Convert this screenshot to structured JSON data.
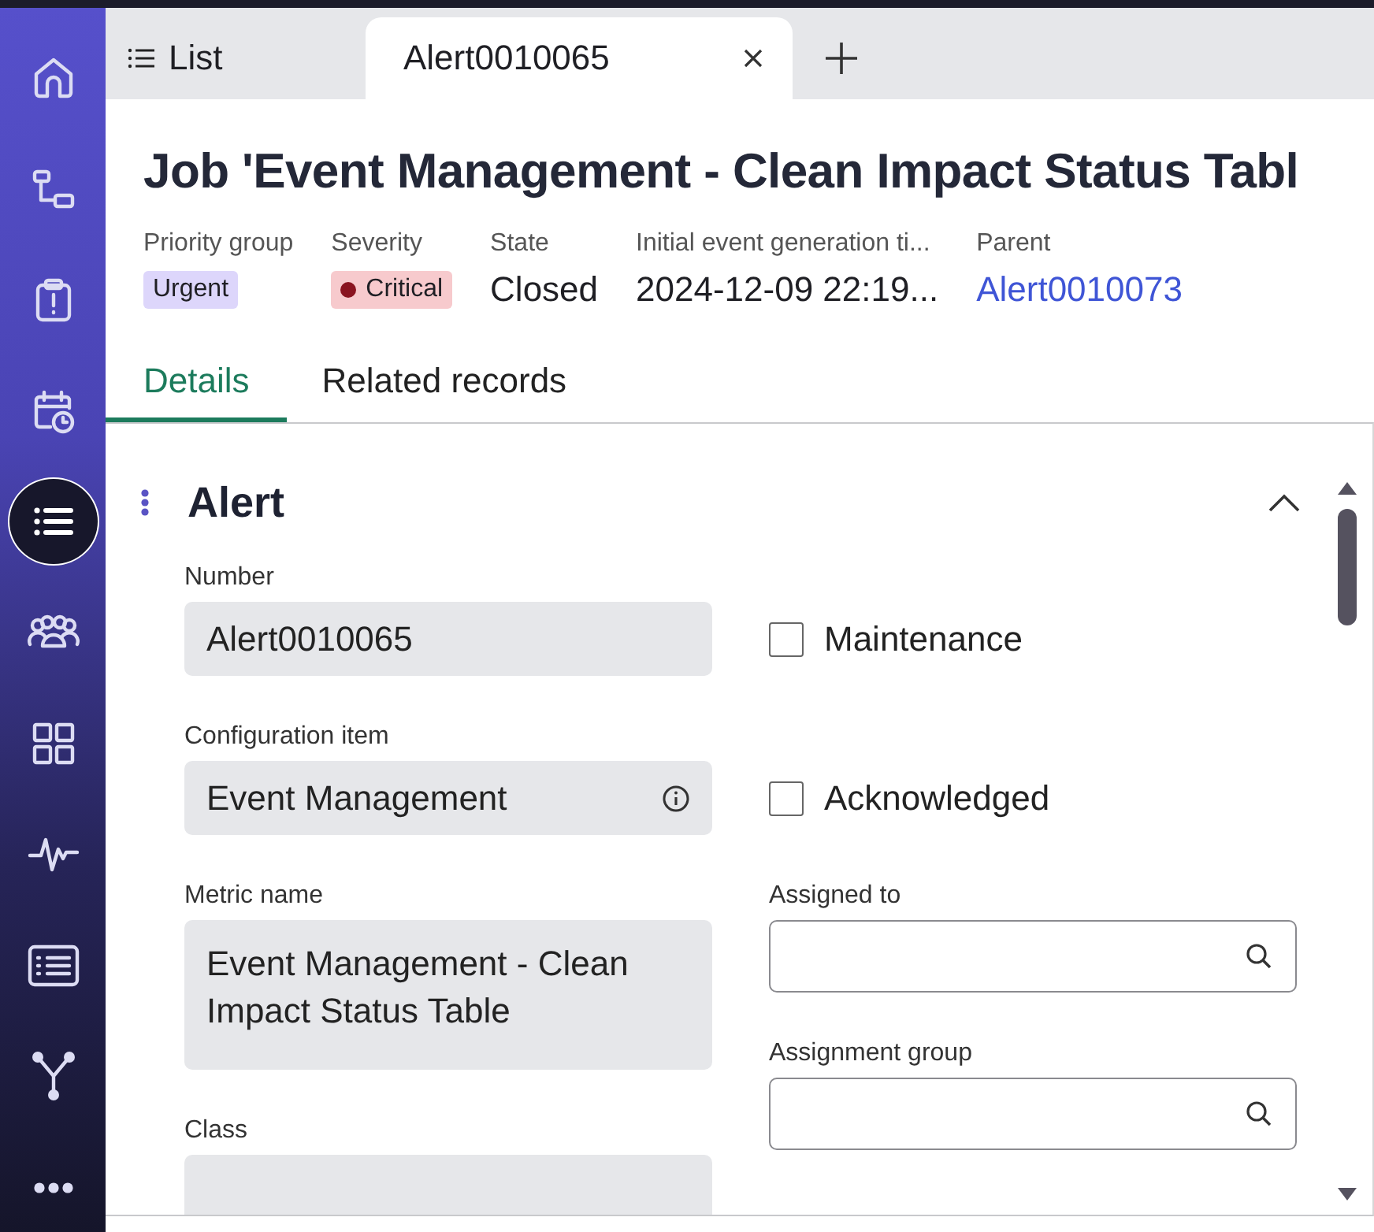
{
  "sidebar": {
    "items": [
      {
        "selected": false
      },
      {
        "selected": false
      },
      {
        "selected": false
      },
      {
        "selected": false
      },
      {
        "selected": true
      },
      {
        "selected": false
      },
      {
        "selected": false
      },
      {
        "selected": false
      },
      {
        "selected": false
      },
      {
        "selected": false
      },
      {
        "selected": false
      }
    ]
  },
  "tabs": [
    {
      "label": "List",
      "kind": "list",
      "selected": false
    },
    {
      "label": "Alert0010065",
      "kind": "record",
      "selected": true
    }
  ],
  "record": {
    "title": "Job 'Event Management - Clean Impact Status Tabl",
    "meta": [
      {
        "label": "Priority group",
        "value": "Urgent",
        "kind": "badge",
        "color": "#ddd6fb"
      },
      {
        "label": "Severity",
        "value": "Critical",
        "kind": "dot-badge",
        "color": "#f7cacd"
      },
      {
        "label": "State",
        "value": "Closed",
        "kind": "text"
      },
      {
        "label": "Initial event generation ti...",
        "value": "2024-12-09 22:19...",
        "kind": "text"
      },
      {
        "label": "Parent",
        "value": "Alert0010073",
        "kind": "link"
      }
    ]
  },
  "detail_tabs": [
    {
      "label": "Details",
      "selected": true
    },
    {
      "label": "Related records",
      "selected": false
    }
  ],
  "section": {
    "title": "Alert",
    "expanded": true,
    "left": [
      {
        "label": "Number",
        "value": "Alert0010065",
        "kind": "readonly",
        "info": false
      },
      {
        "label": "Configuration item",
        "value": "Event Management",
        "kind": "readonly",
        "info": true
      },
      {
        "label": "Metric name",
        "value": "Event Management - Clean Impact Status Table",
        "kind": "multiline",
        "info": false
      },
      {
        "label": "Class",
        "kind": "readonly",
        "info": false
      }
    ],
    "right": [
      {
        "label": "Maintenance",
        "kind": "checkbox",
        "checked": false
      },
      {
        "label": "Acknowledged",
        "kind": "checkbox",
        "checked": false
      },
      {
        "label": "Assigned to",
        "kind": "lookup"
      },
      {
        "label": "Assignment group",
        "kind": "lookup"
      }
    ]
  }
}
